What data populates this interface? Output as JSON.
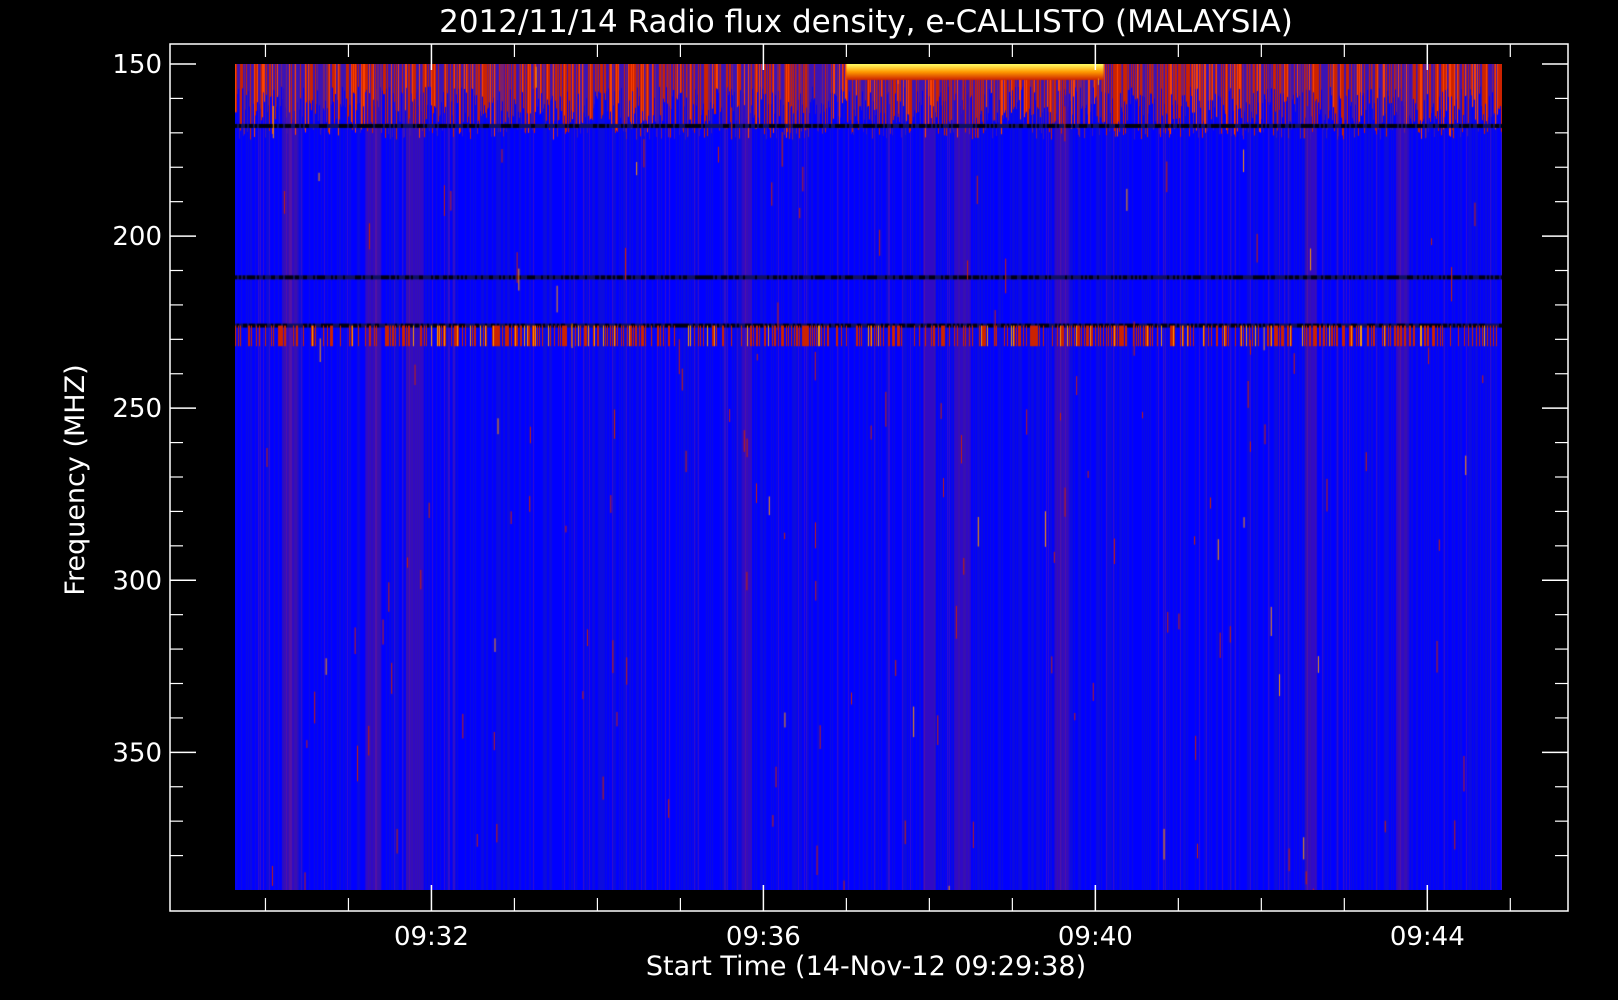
{
  "chart_data": {
    "type": "heatmap",
    "title": "2012/11/14  Radio flux density, e-CALLISTO (MALAYSIA)",
    "xlabel": "Start Time (14-Nov-12 09:29:38)",
    "ylabel": "Frequency (MHZ)",
    "x_tick_labels": [
      "09:32",
      "09:36",
      "09:40",
      "09:44"
    ],
    "y_tick_labels": [
      "150",
      "200",
      "250",
      "300",
      "350"
    ],
    "x_range_minutes": [
      29.633,
      44.9
    ],
    "y_range_mhz": [
      150,
      390
    ],
    "y_axis_inverted": true,
    "colormap": [
      "#000000",
      "#0000ff",
      "#2020e8",
      "#7a1f6e",
      "#cc2200",
      "#ff4400",
      "#ff9900",
      "#ffff66"
    ],
    "features": {
      "broadband_top_band_mhz": [
        150,
        172
      ],
      "bright_burst_top_minutes": [
        37.0,
        40.1
      ],
      "dark_lines_mhz": [
        168,
        212,
        226
      ],
      "red_band_mhz": [
        226,
        232
      ],
      "vertical_streak_minutes": [
        30.3,
        31.3,
        31.8,
        35.8,
        38.0,
        38.4,
        39.6,
        42.6,
        43.7
      ]
    }
  }
}
